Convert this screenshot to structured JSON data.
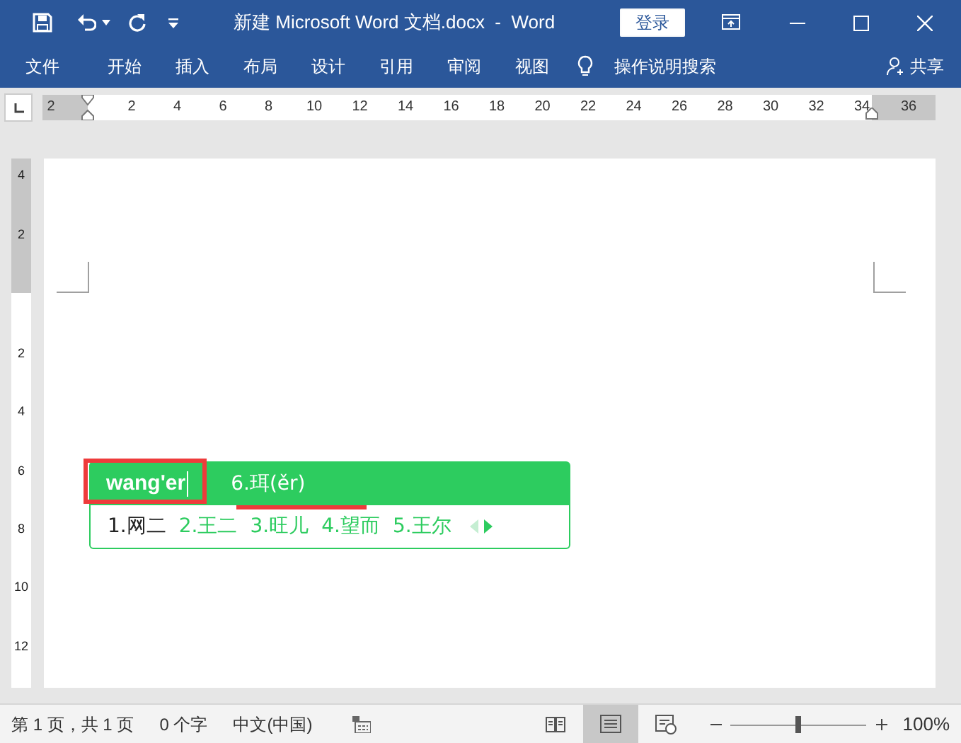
{
  "title_bar": {
    "title": "新建 Microsoft Word 文档.docx  -  Word",
    "login_button": "登录"
  },
  "ribbon_tabs": [
    {
      "label": "文件"
    },
    {
      "label": "开始"
    },
    {
      "label": "插入"
    },
    {
      "label": "布局"
    },
    {
      "label": "设计"
    },
    {
      "label": "引用"
    },
    {
      "label": "审阅"
    },
    {
      "label": "视图"
    }
  ],
  "tell_me": "操作说明搜索",
  "share": "共享",
  "ruler": {
    "labels": [
      "2",
      "2",
      "4",
      "6",
      "8",
      "10",
      "12",
      "14",
      "16",
      "18",
      "20",
      "22",
      "24",
      "26",
      "28",
      "30",
      "32",
      "34",
      "36"
    ]
  },
  "vertical_ruler": {
    "labels": [
      "4",
      "2",
      "2",
      "4",
      "6",
      "8",
      "10",
      "12"
    ]
  },
  "ime": {
    "composition": "wang'er",
    "highlighted_candidate": "6.珥(ěr)",
    "candidates": [
      {
        "text": "1.网二",
        "selected": true
      },
      {
        "text": "2.王二",
        "selected": false
      },
      {
        "text": "3.旺儿",
        "selected": false
      },
      {
        "text": "4.望而",
        "selected": false
      },
      {
        "text": "5.王尔",
        "selected": false
      }
    ],
    "previous_enabled": false,
    "next_enabled": true
  },
  "status_bar": {
    "page": "第 1 页，共 1 页",
    "words": "0 个字",
    "language": "中文(中国)",
    "views": [
      {
        "kind": "read",
        "selected": false
      },
      {
        "kind": "print",
        "selected": true
      },
      {
        "kind": "web",
        "selected": false
      }
    ],
    "zoom_slider": {
      "level": 0.5
    },
    "zoom": "100%"
  }
}
